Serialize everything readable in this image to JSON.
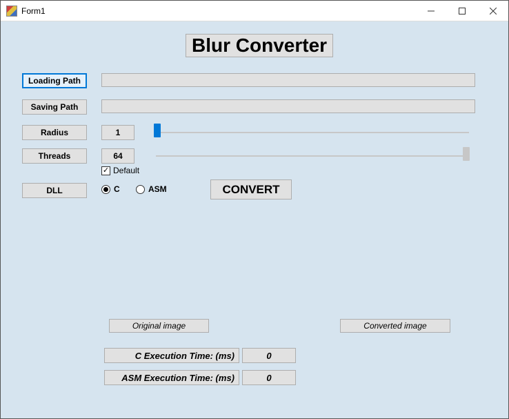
{
  "window": {
    "title": "Form1"
  },
  "heading": "Blur Converter",
  "buttons": {
    "loading_path": "Loading Path",
    "saving_path": "Saving Path",
    "radius": "Radius",
    "threads": "Threads",
    "dll": "DLL",
    "convert": "CONVERT"
  },
  "inputs": {
    "loading_path_value": "",
    "saving_path_value": ""
  },
  "values": {
    "radius": "1",
    "threads": "64"
  },
  "checkbox": {
    "default_label": "Default",
    "default_checked": true
  },
  "radios": {
    "c_label": "C",
    "asm_label": "ASM",
    "selected": "C"
  },
  "labels": {
    "original_image": "Original image",
    "converted_image": "Converted image",
    "c_exec": "C Execution Time: (ms)",
    "asm_exec": "ASM Execution Time: (ms)"
  },
  "exec": {
    "c_value": "0",
    "asm_value": "0"
  }
}
